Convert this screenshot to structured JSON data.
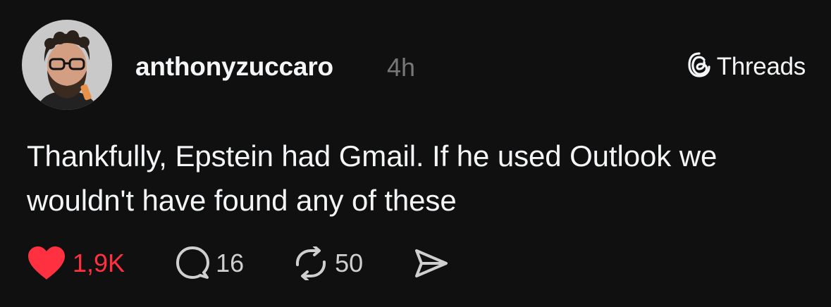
{
  "post": {
    "author": {
      "username": "anthonyzuccaro",
      "avatar_icon": "profile-photo"
    },
    "time_ago": "4h",
    "brand": {
      "label": "Threads",
      "icon": "threads-logo-icon"
    },
    "text": "Thankfully, Epstein had Gmail. If he used Outlook we wouldn't have found any of these",
    "actions": {
      "likes": "1,9K",
      "replies": "16",
      "reposts": "50"
    }
  },
  "colors": {
    "background": "#101010",
    "text": "#f3f5f7",
    "muted": "#777777",
    "like": "#ff3040"
  }
}
